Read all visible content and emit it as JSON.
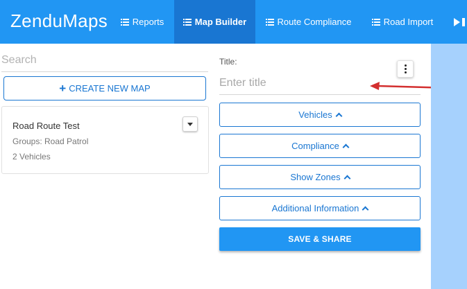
{
  "header": {
    "brand": "ZenduMaps",
    "nav": [
      {
        "label": "Reports"
      },
      {
        "label": "Map Builder"
      },
      {
        "label": "Route Compliance"
      },
      {
        "label": "Road Import"
      }
    ]
  },
  "sidebar": {
    "search_placeholder": "Search",
    "create_button": "CREATE NEW MAP",
    "maps": [
      {
        "name": "Road Route Test",
        "groups": "Groups: Road Patrol",
        "vehicles": "2 Vehicles"
      }
    ]
  },
  "form": {
    "title_label": "Title:",
    "title_placeholder": "Enter title",
    "sections": [
      {
        "label": "Vehicles"
      },
      {
        "label": "Compliance"
      },
      {
        "label": "Show Zones"
      },
      {
        "label": "Additional Information"
      }
    ],
    "save_button": "SAVE & SHARE"
  },
  "colors": {
    "primary": "#2196f3",
    "primary_dark": "#1976d2",
    "map_bg": "#a6d1fd",
    "annotation": "#d32f2f"
  }
}
